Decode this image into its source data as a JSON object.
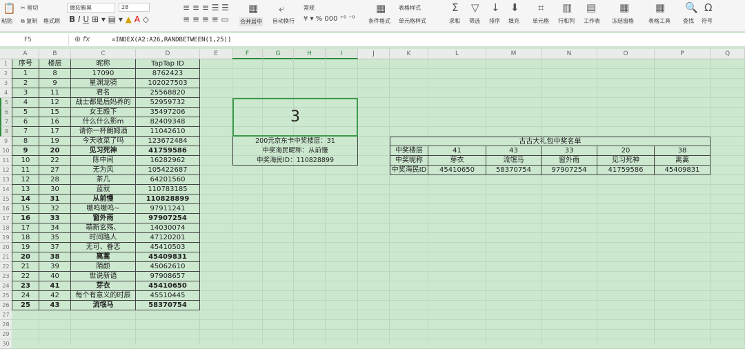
{
  "ribbon": {
    "paste": "粘贴",
    "cut": "剪切",
    "copy": "复制",
    "format_painter": "格式刷",
    "font": "微软雅黑",
    "size": "28",
    "merge": "合并居中",
    "wrap": "自动换行",
    "num_format": "常规",
    "cond_format": "条件格式",
    "table_style": "表格样式",
    "cell_style": "单元格样式",
    "sum": "求和",
    "filter": "筛选",
    "sort": "排序",
    "fill": "填充",
    "cells": "单元格",
    "rowcol": "行和列",
    "sheet": "工作表",
    "freeze": "冻结窗格",
    "tools": "表格工具",
    "find": "查找",
    "symbol": "符号"
  },
  "formula_bar": {
    "cell": "F5",
    "fx": "fx",
    "formula": "=INDEX(A2:A26,RANDBETWEEN(1,25))"
  },
  "columns": [
    "A",
    "B",
    "C",
    "D",
    "E",
    "F",
    "G",
    "H",
    "I",
    "J",
    "K",
    "L",
    "M",
    "N",
    "O",
    "P",
    "Q"
  ],
  "table": {
    "headers": [
      "序号",
      "楼层",
      "昵称",
      "TapTap ID"
    ],
    "rows": [
      [
        "1",
        "8",
        "17090",
        "8762423"
      ],
      [
        "2",
        "9",
        "星渊龙骑",
        "102027503"
      ],
      [
        "3",
        "11",
        "君名",
        "25568820"
      ],
      [
        "4",
        "12",
        "战士都是后妈养的",
        "52959732"
      ],
      [
        "5",
        "15",
        "女王殿下",
        "35497206"
      ],
      [
        "6",
        "16",
        "什么什么影m",
        "82409348"
      ],
      [
        "7",
        "17",
        "请你一杯朗姆酒",
        "11042610"
      ],
      [
        "8",
        "19",
        "今天收菜了吗",
        "123672484"
      ],
      [
        "9",
        "20",
        "见习死神",
        "41759586"
      ],
      [
        "10",
        "22",
        "陈中间",
        "16282962"
      ],
      [
        "11",
        "27",
        "无为风",
        "105422687"
      ],
      [
        "12",
        "28",
        "茶几",
        "64201560"
      ],
      [
        "13",
        "30",
        "蓝就",
        "110783185"
      ],
      [
        "14",
        "31",
        "从前慢",
        "110828899"
      ],
      [
        "15",
        "32",
        "嗷呜嗷呜~",
        "97911241"
      ],
      [
        "16",
        "33",
        "窗外雨",
        "97907254"
      ],
      [
        "17",
        "34",
        "萌新玄殇、",
        "14030074"
      ],
      [
        "18",
        "35",
        "时间路人",
        "47120201"
      ],
      [
        "19",
        "37",
        "无可、眷恋",
        "45410503"
      ],
      [
        "20",
        "38",
        "离蒿",
        "45409831"
      ],
      [
        "21",
        "39",
        "陌颜",
        "45062610"
      ],
      [
        "22",
        "40",
        "世说新语",
        "97908657"
      ],
      [
        "23",
        "41",
        "芽衣",
        "45410650"
      ],
      [
        "24",
        "42",
        "每个有意义的时辰",
        "45510445"
      ],
      [
        "25",
        "43",
        "流氓马",
        "58370754"
      ]
    ],
    "bold_rows": [
      9,
      14,
      16,
      20,
      23,
      25
    ]
  },
  "draw": {
    "result": "3",
    "lines": [
      "200元京东卡中奖楼层：31",
      "中奖海民昵称：从前慢",
      "中奖海民ID：110828899"
    ]
  },
  "winners": {
    "title": "古古大礼包中奖名单",
    "labels": [
      "中奖楼层",
      "中奖昵称",
      "中奖海民ID"
    ],
    "floors": [
      "41",
      "43",
      "33",
      "20",
      "38"
    ],
    "names": [
      "芽衣",
      "流氓马",
      "窗外雨",
      "见习死神",
      "离蒿"
    ],
    "ids": [
      "45410650",
      "58370754",
      "97907254",
      "41759586",
      "45409831"
    ]
  }
}
